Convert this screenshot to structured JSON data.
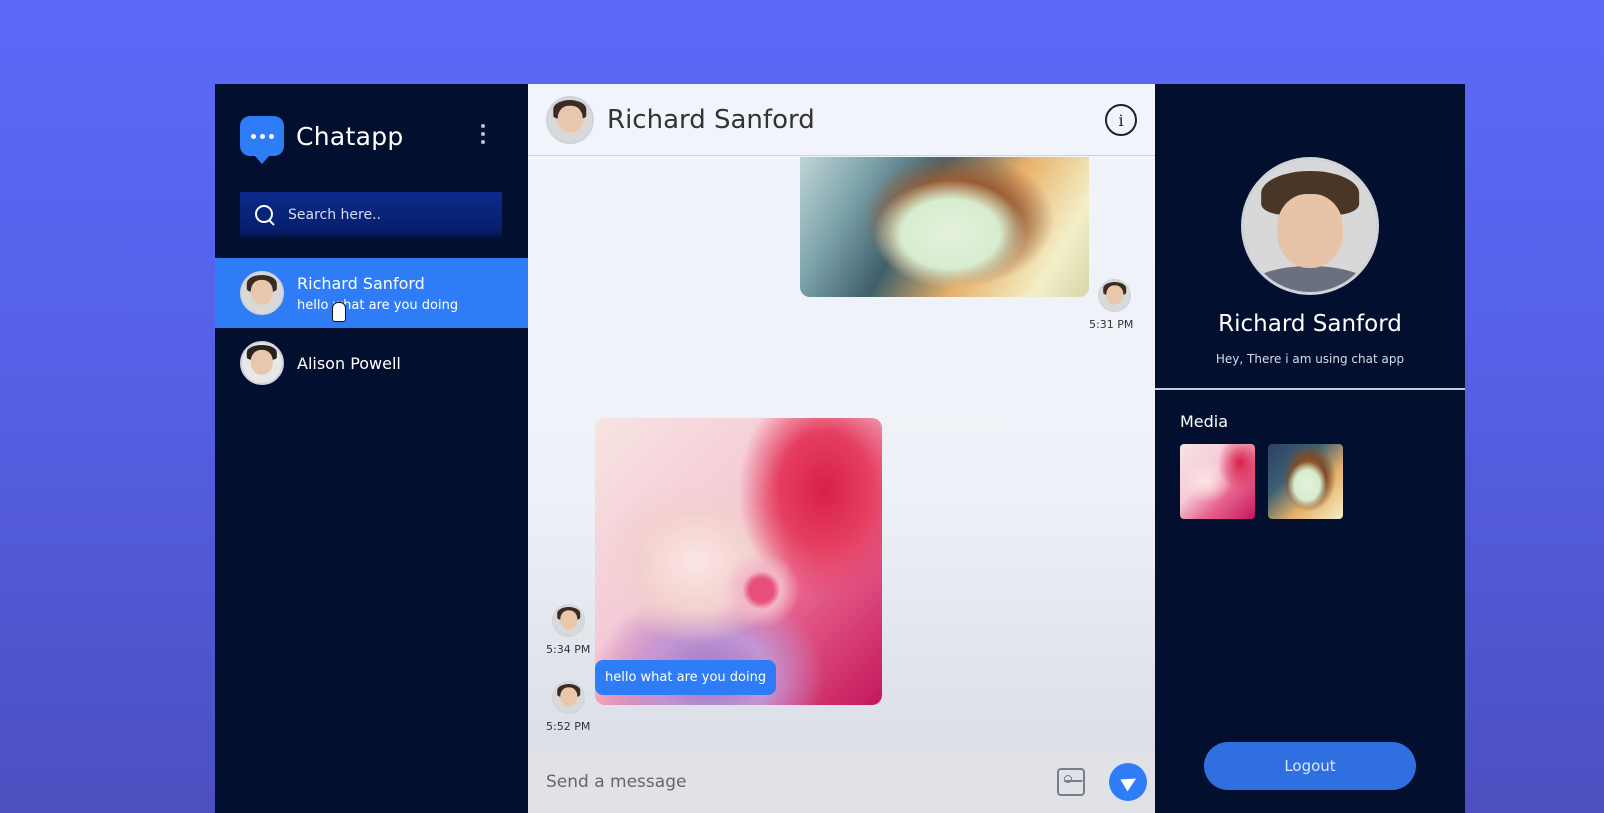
{
  "app": {
    "name": "Chatapp",
    "brand_color": "#2f7df6",
    "background_color": "#020f2e"
  },
  "sidebar": {
    "menu_icon": "kebab-menu-icon",
    "search": {
      "placeholder": "Search here..",
      "value": ""
    },
    "contacts": [
      {
        "name": "Richard Sanford",
        "last_message": "hello what are you doing",
        "active": true
      },
      {
        "name": "Alison Powell",
        "last_message": "",
        "active": false
      }
    ]
  },
  "chat": {
    "header": {
      "name": "Richard Sanford",
      "info_icon": "info-icon"
    },
    "messages": [
      {
        "type": "image",
        "direction": "sent",
        "time": "5:31 PM"
      },
      {
        "type": "image",
        "direction": "received",
        "time": "5:34 PM"
      },
      {
        "type": "text",
        "direction": "received",
        "text": "hello what are you doing",
        "time": "5:52 PM"
      }
    ],
    "composer": {
      "placeholder": "Send a message",
      "value": "",
      "attach_icon": "image-attach-icon",
      "send_icon": "send-icon"
    }
  },
  "profile": {
    "name": "Richard Sanford",
    "status": "Hey, There i am using chat app",
    "media_title": "Media",
    "media_count": 2,
    "logout_label": "Logout"
  }
}
